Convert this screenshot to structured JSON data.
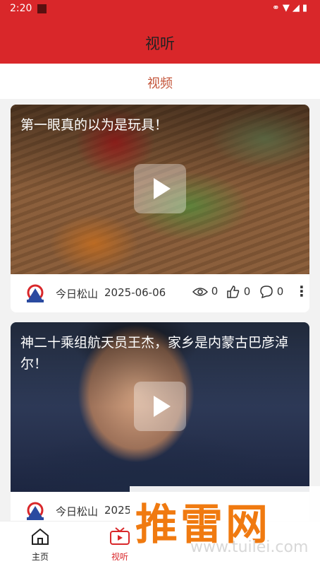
{
  "status_bar": {
    "time": "2:20",
    "icons": [
      "link-icon",
      "wifi-icon",
      "signal-icon",
      "battery-icon"
    ]
  },
  "header": {
    "title": "视听"
  },
  "tabs": [
    {
      "label": "视频",
      "active": true
    }
  ],
  "videos": [
    {
      "title": "第一眼真的以为是玩具！",
      "source": "今日松山",
      "date": "2025-06-06",
      "views": "0",
      "likes": "0",
      "comments": "0"
    },
    {
      "title": "神二十乘组航天员王杰，家乡是内蒙古巴彦淖尔！",
      "source": "今日松山",
      "date": "2025"
    }
  ],
  "bottom_nav": [
    {
      "label": "主页",
      "icon": "home-icon"
    },
    {
      "label": "视听",
      "icon": "tv-icon",
      "active": true
    }
  ],
  "watermark": {
    "brand": "推雷网",
    "url": "www.tuilei.com"
  },
  "colors": {
    "primary": "#d9272a",
    "tab_active": "#c4553a",
    "watermark": "#f07a10"
  }
}
